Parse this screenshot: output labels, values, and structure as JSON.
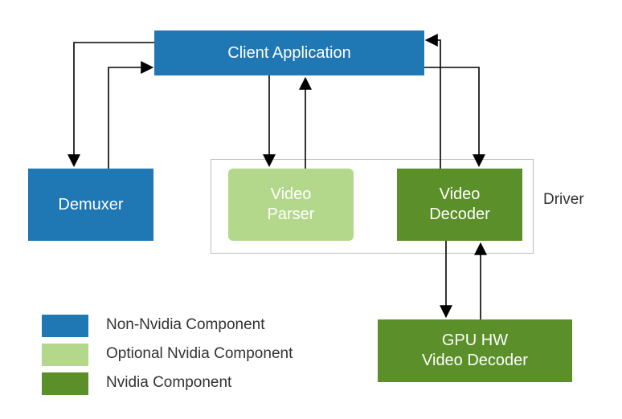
{
  "diagram": {
    "nodes": {
      "client_app": {
        "label": "Client Application",
        "category": "non_nvidia"
      },
      "demuxer": {
        "label": "Demuxer",
        "category": "non_nvidia"
      },
      "video_parser": {
        "label": "Video\nParser",
        "category": "optional_nvidia"
      },
      "video_decoder": {
        "label": "Video\nDecoder",
        "category": "nvidia"
      },
      "gpu_hw_decoder": {
        "label": "GPU HW\nVideo Decoder",
        "category": "nvidia"
      }
    },
    "driver_group": {
      "label": "Driver",
      "contains": [
        "video_parser",
        "video_decoder"
      ]
    },
    "edges": [
      {
        "from": "client_app",
        "to": "demuxer",
        "bidir": true
      },
      {
        "from": "client_app",
        "to": "video_parser",
        "bidir": true
      },
      {
        "from": "client_app",
        "to": "video_decoder",
        "bidir": true
      },
      {
        "from": "video_decoder",
        "to": "gpu_hw_decoder",
        "bidir": true
      }
    ]
  },
  "legend": {
    "items": [
      {
        "key": "non_nvidia",
        "label": "Non-Nvidia Component",
        "color": "#1f77b4"
      },
      {
        "key": "optional_nvidia",
        "label": "Optional Nvidia Component",
        "color": "#b4d88b"
      },
      {
        "key": "nvidia",
        "label": "Nvidia Component",
        "color": "#5b8f29"
      }
    ]
  },
  "colors": {
    "non_nvidia": "#1f77b4",
    "optional_nvidia": "#b4d88b",
    "nvidia": "#5b8f29",
    "arrow": "#000000"
  }
}
